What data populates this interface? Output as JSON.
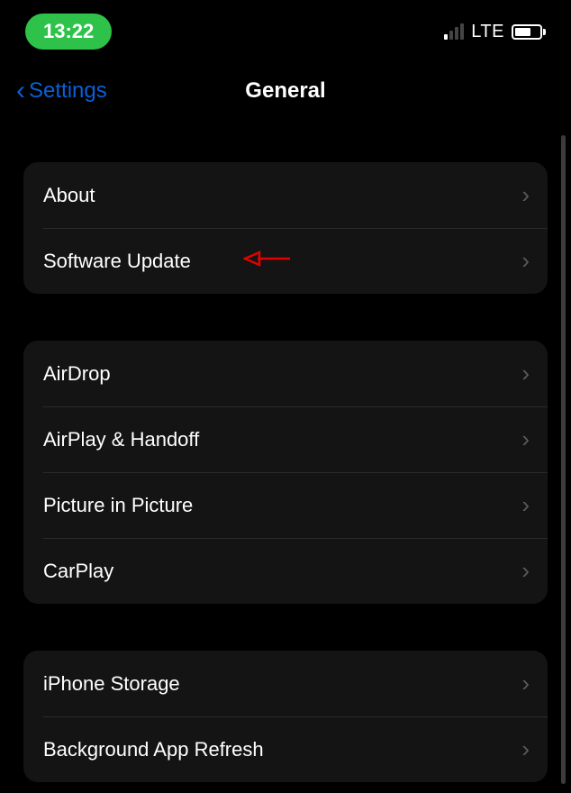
{
  "status": {
    "time": "13:22",
    "network": "LTE"
  },
  "nav": {
    "back_label": "Settings",
    "title": "General"
  },
  "groups": [
    {
      "rows": [
        {
          "label": "About"
        },
        {
          "label": "Software Update"
        }
      ]
    },
    {
      "rows": [
        {
          "label": "AirDrop"
        },
        {
          "label": "AirPlay & Handoff"
        },
        {
          "label": "Picture in Picture"
        },
        {
          "label": "CarPlay"
        }
      ]
    },
    {
      "rows": [
        {
          "label": "iPhone Storage"
        },
        {
          "label": "Background App Refresh"
        }
      ]
    }
  ],
  "annotation": {
    "arrow_color": "#e30000"
  }
}
